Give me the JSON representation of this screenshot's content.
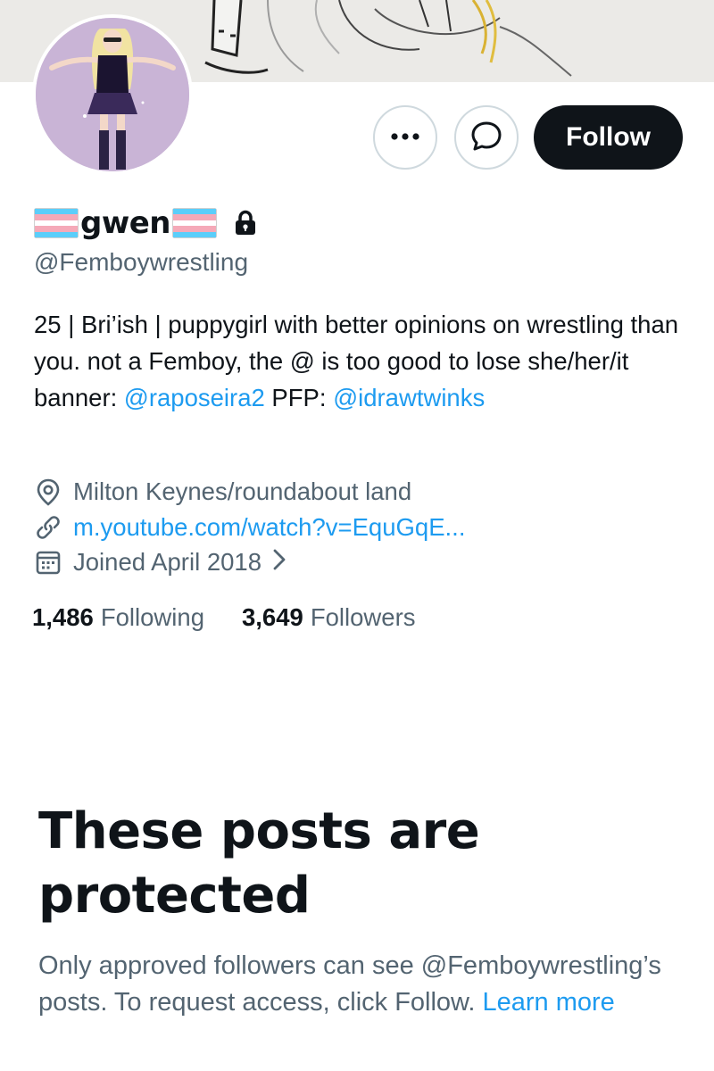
{
  "profile": {
    "display_name": "gwen",
    "handle": "@Femboywrestling",
    "bio_text": "25 | Bri’ish | puppygirl with better opinions on wrestling than you. not a Femboy, the @ is too good to lose she/her/it banner: ",
    "bio_mention_banner": "@raposeira2",
    "bio_pfp_label": " PFP: ",
    "bio_mention_pfp": "@idrawtwinks",
    "location": "Milton Keynes/roundabout land",
    "website": "m.youtube.com/watch?v=EquGqE...",
    "joined": "Joined April 2018",
    "following_count": "1,486",
    "following_label": "Following",
    "followers_count": "3,649",
    "followers_label": "Followers"
  },
  "actions": {
    "more_label": "•••",
    "follow_label": "Follow"
  },
  "protected": {
    "title": "These posts are protected",
    "text": "Only approved followers can see @Femboywrestling’s posts. To request access, click Follow. ",
    "learn_more": "Learn more"
  },
  "icons": {
    "more": "more-icon",
    "message": "message-icon",
    "lock": "lock-icon",
    "location": "location-icon",
    "link": "link-icon",
    "calendar": "calendar-icon",
    "chevron": "chevron-right-icon",
    "flag": "transgender-flag-icon"
  },
  "colors": {
    "accent": "#1d9bf0",
    "text_primary": "#0f1419",
    "text_secondary": "#536471",
    "follow_button": "#0f1419",
    "flag_blue": "#5bcefa",
    "flag_pink": "#f5a9b8"
  }
}
